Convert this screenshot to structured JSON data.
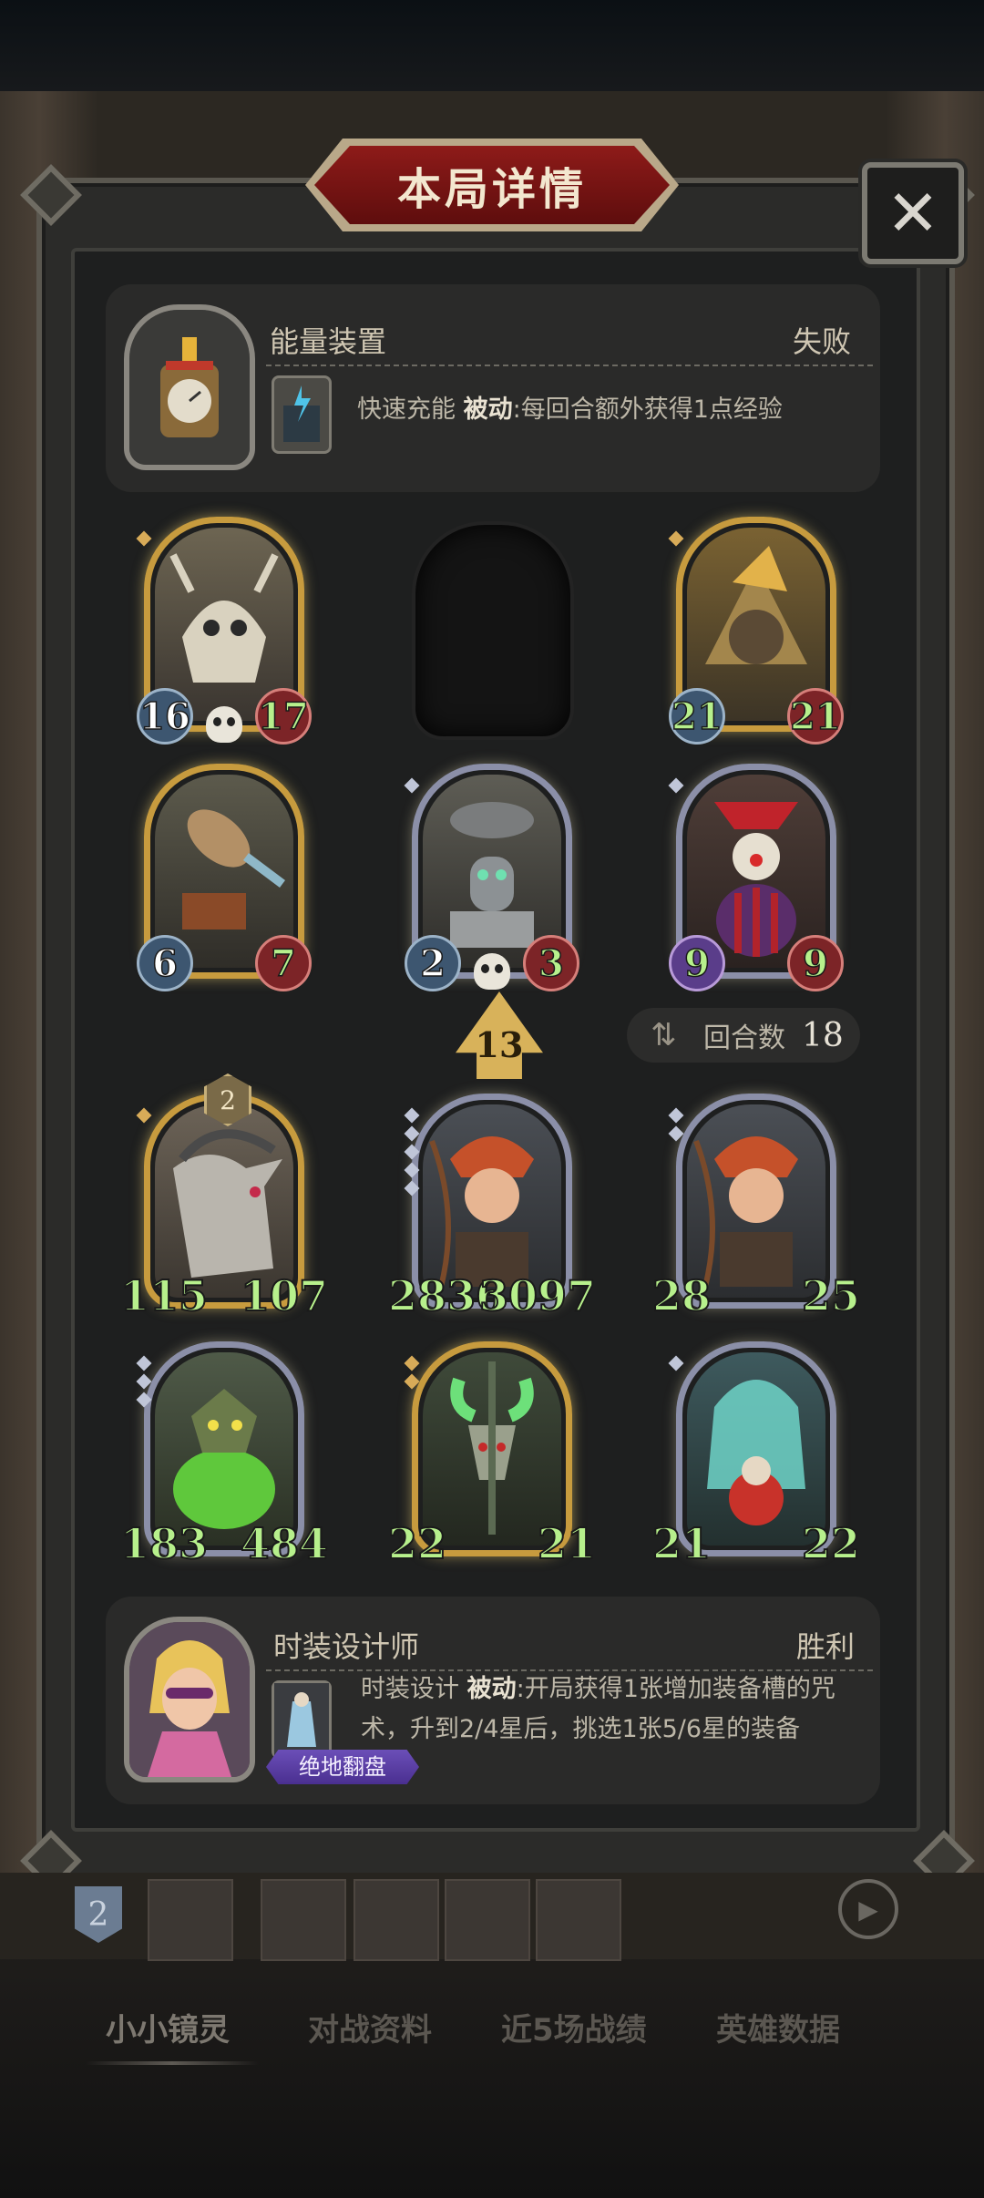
{
  "title": "本局详情",
  "close_icon": "close-icon",
  "opponent": {
    "name": "能量装置",
    "result": "失败",
    "skill_name": "快速充能",
    "skill_type": "被动",
    "skill_desc": ":每回合额外获得1点经验"
  },
  "opponent_cards": [
    {
      "atk": "16",
      "hp": "17",
      "frame": "gold"
    },
    {
      "empty": true
    },
    {
      "atk": "21",
      "hp": "21",
      "frame": "gold"
    },
    {
      "atk": "6",
      "hp": "7",
      "frame": "gold"
    },
    {
      "atk": "2",
      "hp": "3",
      "frame": "silver"
    },
    {
      "atk": "9",
      "hp": "9",
      "frame": "silver"
    }
  ],
  "level": "13",
  "round": {
    "label": "回合数",
    "value": "18"
  },
  "player_cards": [
    {
      "atk": "115",
      "hp": "107",
      "frame": "gold",
      "tier": "2"
    },
    {
      "atk": "2836",
      "hp": "3097",
      "frame": "silver"
    },
    {
      "atk": "28",
      "hp": "25",
      "frame": "silver"
    },
    {
      "atk": "183",
      "hp": "484",
      "frame": "silver"
    },
    {
      "atk": "22",
      "hp": "21",
      "frame": "gold"
    },
    {
      "atk": "21",
      "hp": "22",
      "frame": "silver"
    }
  ],
  "player": {
    "name": "时装设计师",
    "result": "胜利",
    "skill_name": "时装设计",
    "skill_type": "被动",
    "skill_desc_line1": ":开局获得1张增加装备槽的咒",
    "skill_desc_line2": "术，升到2/4星后，挑选1张5/6星的装备",
    "badge": "绝地翻盘"
  },
  "bottom": {
    "rank": "2",
    "tabs": [
      "小小镜灵",
      "对战资料",
      "近5场战绩",
      "英雄数据"
    ]
  },
  "colors": {
    "title_red": "#8e1b19",
    "stat_green": "#b7f08c",
    "gold_frame": "#c79b3e",
    "silver_frame": "#8b8fa8",
    "badge_purple": "#6b4fb8"
  }
}
